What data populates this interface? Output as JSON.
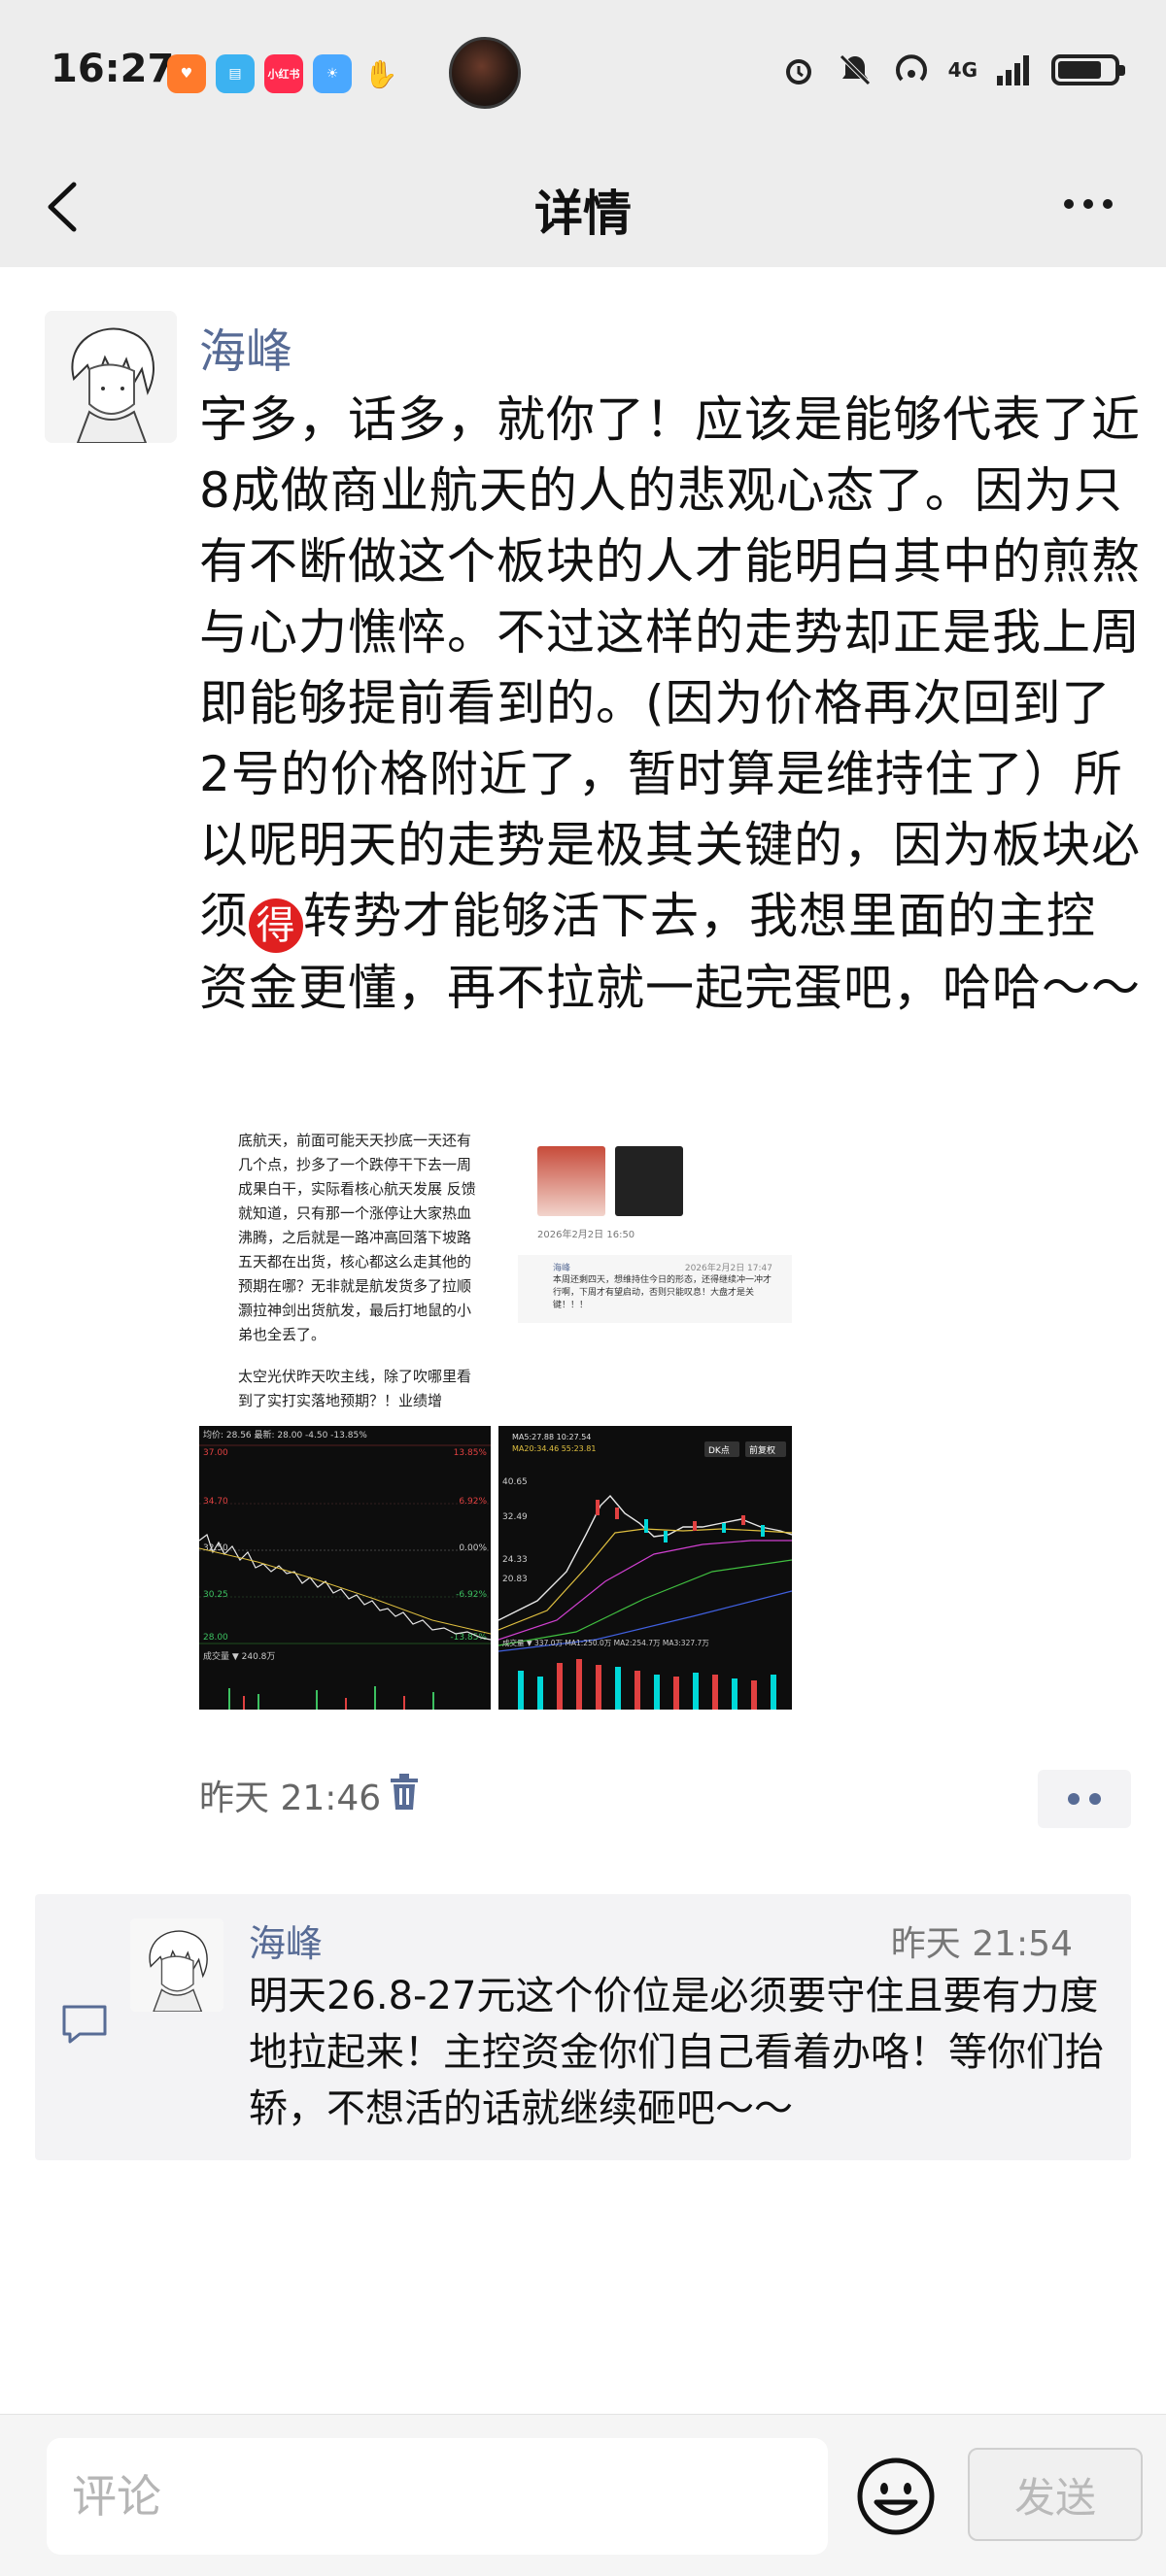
{
  "status_bar": {
    "time": "16:27",
    "app_icons": [
      "taobao",
      "reader",
      "xiaohongshu",
      "weather",
      "hand"
    ],
    "app_icon_labels": [
      "",
      "",
      "小红书",
      "",
      ""
    ],
    "network": "4G"
  },
  "nav": {
    "title": "详情"
  },
  "post": {
    "author": "海峰",
    "text_before_badge": "字多，话多，就你了！应该是能够代表了近8成做商业航天的人的悲观心态了。因为只有不断做这个板块的人才能明白其中的煎熬与心力憔悴。不过这样的走势却正是我上周即能够提前看到的。(因为价格再次回到了2号的价格附近了，暂时算是维持住了）所以呢明天的走势是极其关键的，因为板块必须",
    "badge_char": "得",
    "text_after_badge": "转势才能够活下去，我想里面的主控资金更懂，再不拉就一起完蛋吧，哈哈～～",
    "time": "昨天 21:46",
    "images": {
      "img1": {
        "para1": "底航天，前面可能天天抄底一天还有几个点，抄多了一个跌停干下去一周成果白干，实际看核心航天发展 反馈就知道，只有那一个涨停让大家热血沸腾，之后就是一路冲高回落下坡路五天都在出货，核心都这么走其他的预期在哪？无非就是航发货多了拉顺灏拉神剑出货航发，最后打地鼠的小弟也全丢了。",
        "para2": "太空光伏昨天吹主线，除了吹哪里看到了实打实落地预期？！业绩增"
      },
      "img2": {
        "date": "2026年2月2日 16:50",
        "card_name": "海峰",
        "card_date": "2026年2月2日 17:47",
        "card_body": "本周还剩四天，想维持住今日的形态，还得继续冲一冲才行啊，下周才有望启动，否则只能叹息！大盘才是关键！！！"
      },
      "img3": {
        "top": "均价: 28.56 最新: 28.00 -4.50 -13.85%",
        "levels": [
          "37.00",
          "34.70",
          "32.50",
          "30.25",
          "28.00"
        ],
        "pct": [
          "13.85%",
          "6.92%",
          "0.00%",
          "-6.92%",
          "-13.85%"
        ],
        "vol": "成交量 ▼ 240.8万"
      },
      "img4": {
        "ma": "MA5:27.88  10:27.54",
        "ma2": "MA20:34.46  55:23.81",
        "dk": "DK点",
        "fq": "前复权",
        "levels": [
          "40.65",
          "32.49",
          "24.33",
          "20.83"
        ],
        "vol": "成交量 ▼ 337.0万 MA1:250.0万 MA2:254.7万 MA3:327.7万"
      }
    }
  },
  "comment": {
    "author": "海峰",
    "time": "昨天 21:54",
    "text": "明天26.8-27元这个价位是必须要守住且要有力度地拉起来！主控资金你们自己看着办咯！等你们抬轿，不想活的话就继续砸吧～～"
  },
  "bottom": {
    "input_placeholder": "评论",
    "send_label": "发送"
  },
  "colors": {
    "link_blue": "#576b95",
    "nav_bg": "#ededed",
    "badge_red": "#e02020"
  }
}
